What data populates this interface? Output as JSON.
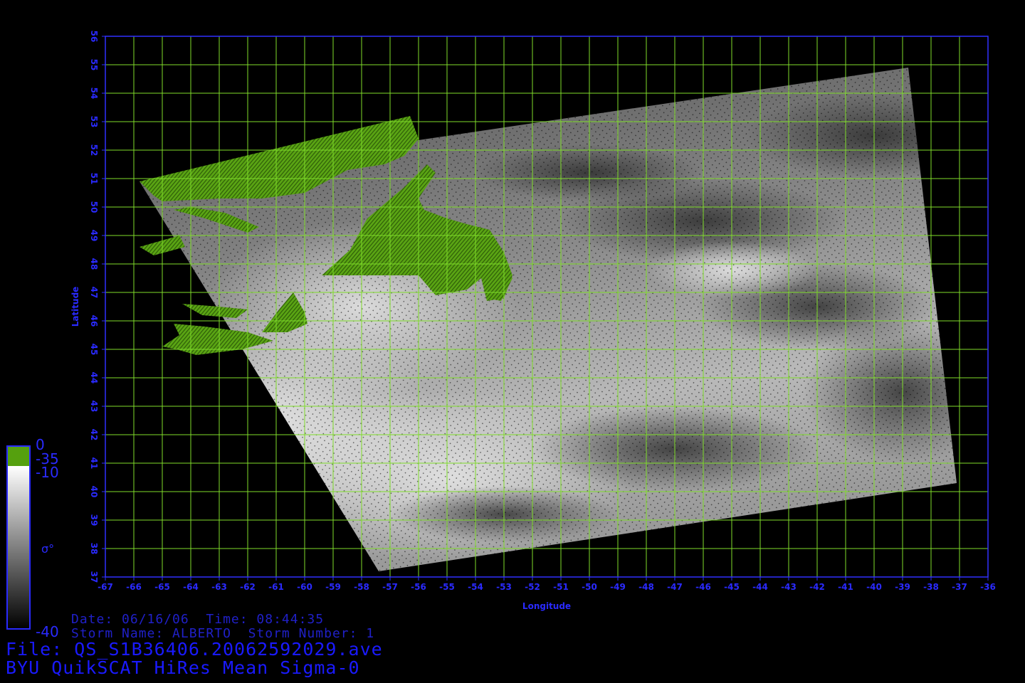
{
  "map": {
    "lon_ticks": [
      "-67",
      "-66",
      "-65",
      "-64",
      "-63",
      "-62",
      "-61",
      "-60",
      "-59",
      "-58",
      "-57",
      "-56",
      "-55",
      "-54",
      "-53",
      "-52",
      "-51",
      "-50",
      "-49",
      "-48",
      "-47",
      "-46",
      "-45",
      "-44",
      "-43",
      "-42",
      "-41",
      "-40",
      "-39",
      "-38",
      "-37",
      "-36"
    ],
    "lat_ticks": [
      "37",
      "38",
      "39",
      "40",
      "41",
      "42",
      "43",
      "44",
      "45",
      "46",
      "47",
      "48",
      "49",
      "50",
      "51",
      "52",
      "53",
      "54",
      "55",
      "56"
    ],
    "xlabel": "Longitude",
    "ylabel": "Latitude",
    "lon_range": [
      -67,
      -36
    ],
    "lat_range": [
      37,
      56
    ],
    "swath_corners_lonlat": [
      [
        -65.8,
        50.9
      ],
      [
        -57.4,
        37.2
      ],
      [
        -37.1,
        40.3
      ],
      [
        -38.8,
        54.9
      ]
    ],
    "colors": {
      "background": "#000000",
      "frame": "#3030ff",
      "grid": "#7fdc2a",
      "land": "#4f9a10",
      "labels": "#2a2aff"
    }
  },
  "colorbar": {
    "label_top": "0",
    "label_land": "-35",
    "label_upper": "-10",
    "label_symbol": "σ°",
    "label_bottom": "-40"
  },
  "info": {
    "date_line": "Date: 06/16/06  Time: 08:44:35",
    "storm_line": "Storm Name: ALBERTO  Storm Number: 1",
    "file_line": "File: QS_S1B36406.20062592029.ave",
    "title_line": "BYU QuikSCAT HiRes Mean Sigma-0"
  }
}
